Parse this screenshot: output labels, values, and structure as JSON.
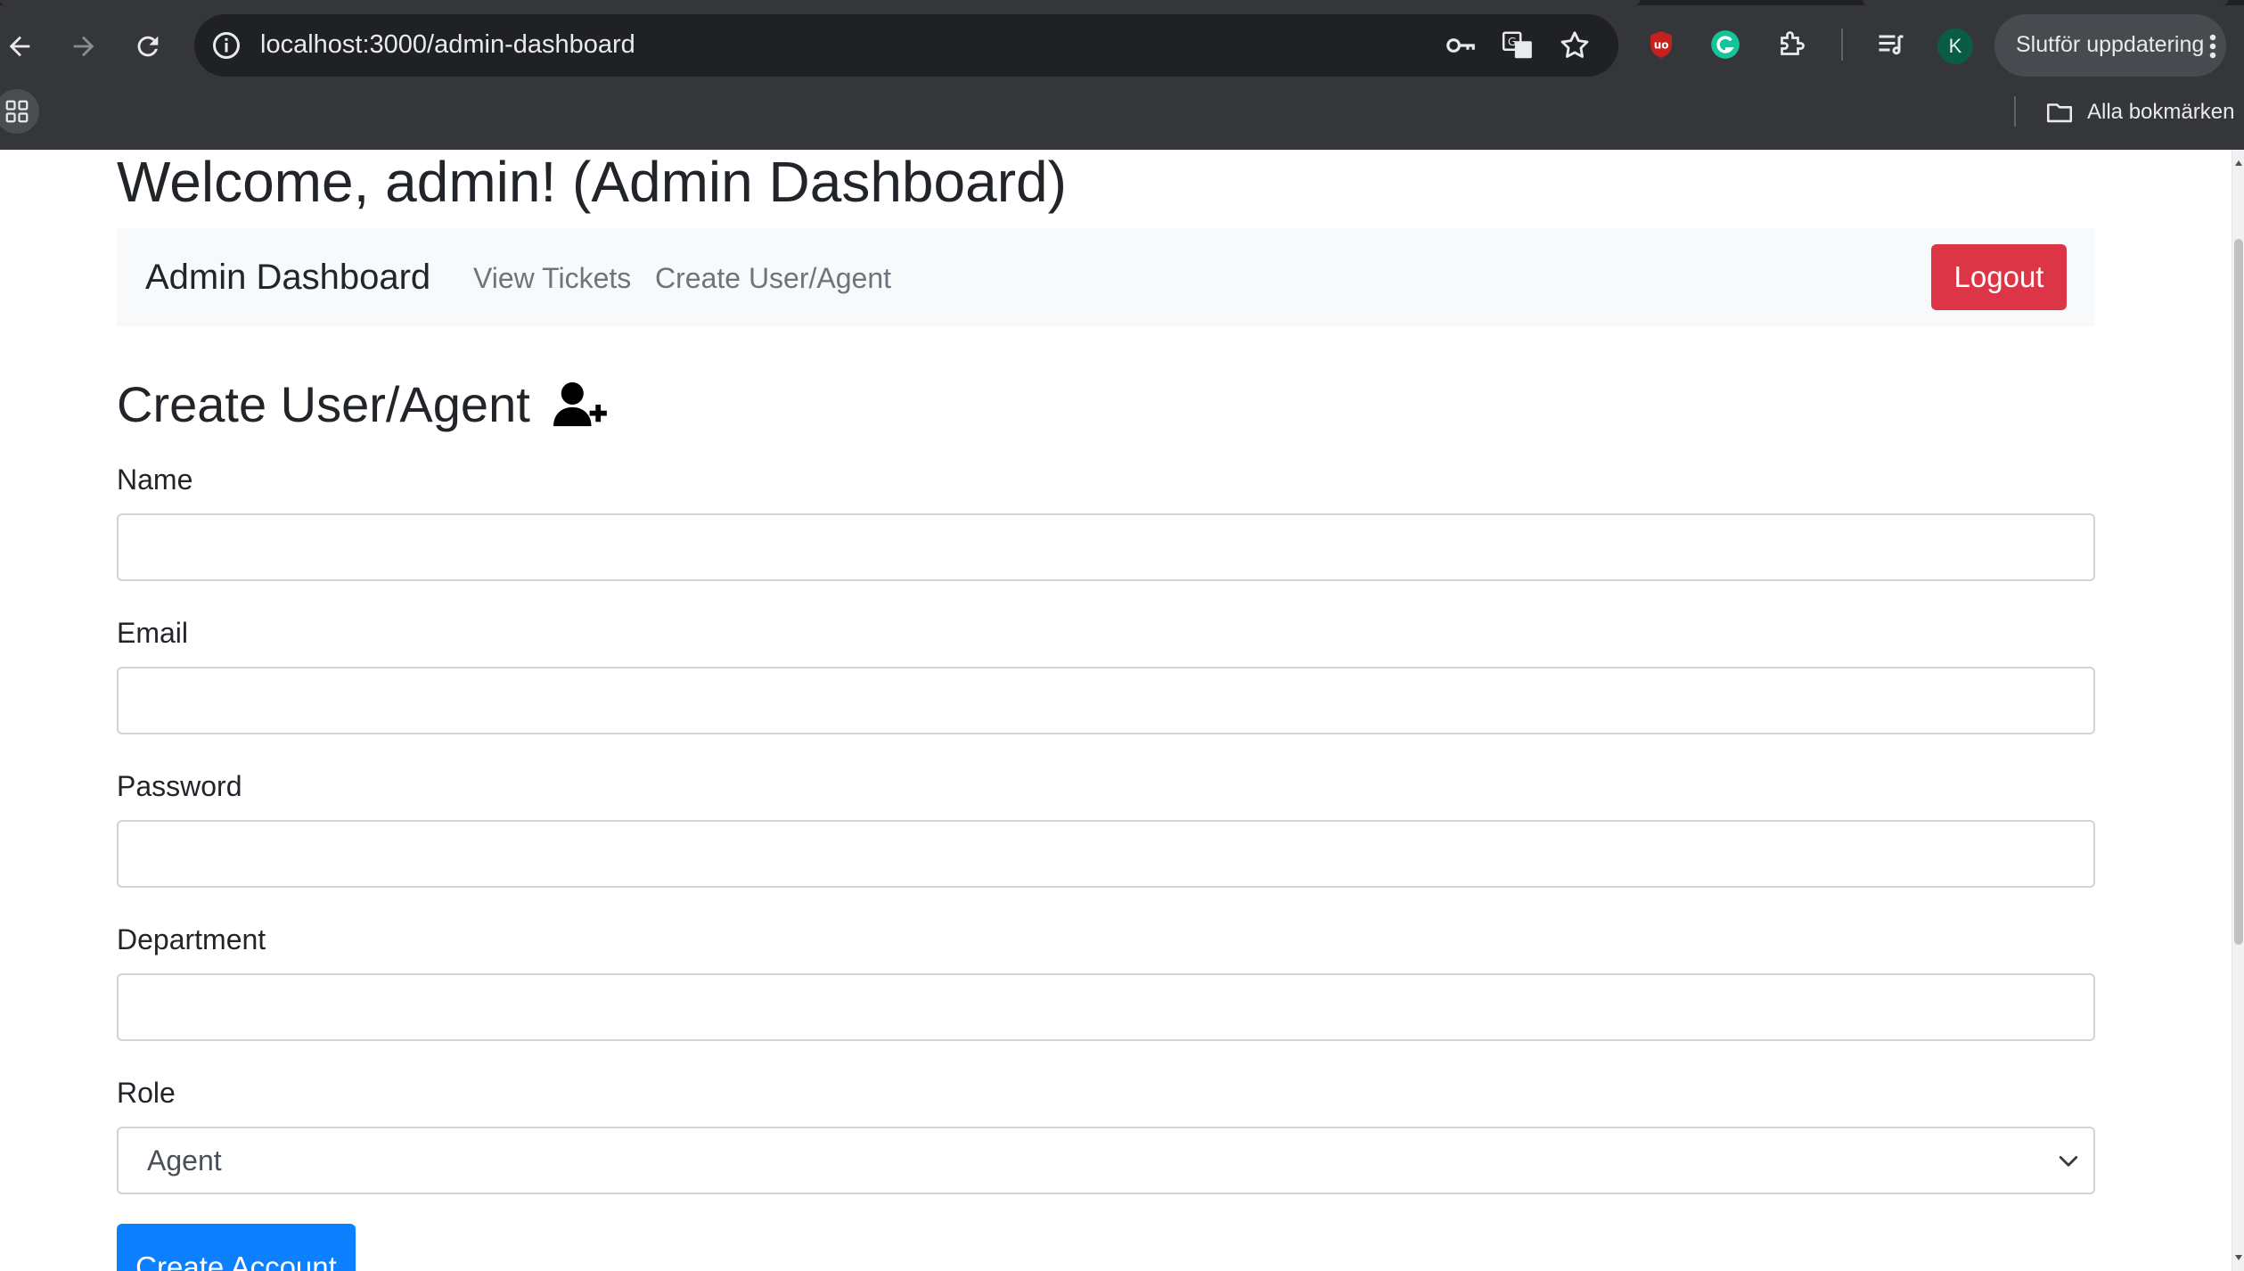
{
  "browser": {
    "url": "localhost:3000/admin-dashboard",
    "profile_initial": "K",
    "update_label": "Slutför uppdatering",
    "bookmarks_label": "Alla bokmärken",
    "icons": {
      "back": "back-arrow-icon",
      "forward": "forward-arrow-icon",
      "reload": "reload-icon",
      "site_info": "site-info-icon",
      "password": "key-icon",
      "translate": "translate-icon",
      "bookmark": "star-icon",
      "ublock": "ublock-icon",
      "grammarly": "grammarly-icon",
      "extensions": "puzzle-icon",
      "reading_list": "reading-list-icon",
      "apps": "apps-grid-icon",
      "folder": "folder-icon",
      "menu": "kebab-menu-icon"
    }
  },
  "page": {
    "welcome": "Welcome, admin! (Admin Dashboard)",
    "navbar": {
      "brand": "Admin Dashboard",
      "links": [
        "View Tickets",
        "Create User/Agent"
      ],
      "logout": "Logout"
    },
    "section_title": "Create User/Agent",
    "section_icon": "user-plus-icon",
    "form": {
      "name_label": "Name",
      "name_value": "",
      "email_label": "Email",
      "email_value": "",
      "password_label": "Password",
      "password_value": "",
      "department_label": "Department",
      "department_value": "",
      "role_label": "Role",
      "role_value": "Agent",
      "submit": "Create Account"
    },
    "colors": {
      "danger": "#dc3545",
      "primary": "#0d80ff",
      "navbar_bg": "#f8f9fa"
    }
  }
}
